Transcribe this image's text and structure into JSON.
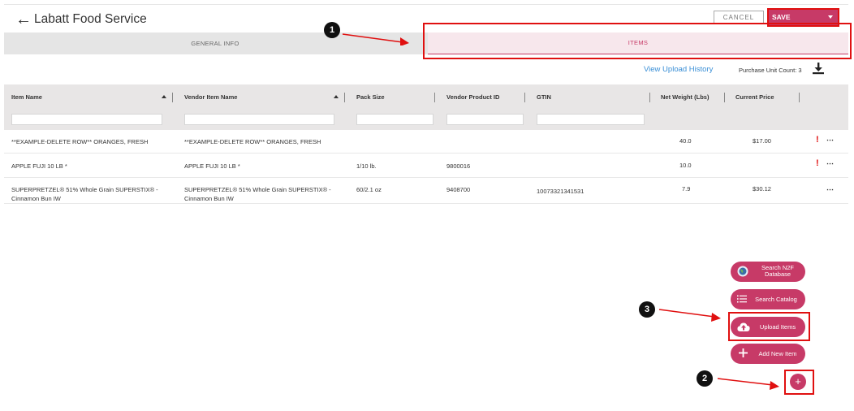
{
  "header": {
    "back_icon": "arrow-left-icon",
    "title": "Labatt Food Service",
    "cancel_label": "CANCEL",
    "save_label": "SAVE"
  },
  "tabs": [
    {
      "label": "GENERAL INFO",
      "active": false
    },
    {
      "label": "ITEMS",
      "active": true
    }
  ],
  "toolbar": {
    "upload_history_link": "View Upload History",
    "purchase_unit_count": "Purchase Unit Count: 3",
    "download_icon": "download-icon"
  },
  "table": {
    "columns": [
      "Item Name",
      "Vendor Item Name",
      "Pack Size",
      "Vendor Product ID",
      "GTIN",
      "Net Weight (Lbs)",
      "Current Price"
    ],
    "rows": [
      {
        "item_name": "**EXAMPLE-DELETE ROW** ORANGES, FRESH",
        "vendor_item_name": "**EXAMPLE-DELETE ROW** ORANGES, FRESH",
        "pack_size": "",
        "vendor_product_id": "",
        "gtin": "",
        "net_weight": "40.0",
        "current_price": "$17.00",
        "warning": "!",
        "menu": "⋯"
      },
      {
        "item_name": "APPLE FUJI 10 LB *",
        "vendor_item_name": "APPLE FUJI 10 LB *",
        "pack_size": "1/10 lb.",
        "vendor_product_id": "9800016",
        "gtin": "",
        "net_weight": "10.0",
        "current_price": "",
        "warning": "!",
        "menu": "⋯"
      },
      {
        "item_name_line1": "SUPERPRETZEL® 51% Whole Grain SUPERSTIX® -",
        "item_name_line2": "Cinnamon Bun IW",
        "vendor_item_name_line1": "SUPERPRETZEL® 51% Whole Grain SUPERSTIX® -",
        "vendor_item_name_line2": "Cinnamon Bun IW",
        "pack_size": "60/2.1 oz",
        "vendor_product_id": "9408700",
        "gtin": "10073321341531",
        "net_weight": "7.9",
        "current_price": "$30.12",
        "menu": "⋯"
      }
    ]
  },
  "fab_menu": [
    {
      "label_line1": "Search N2F",
      "label_line2": "Database",
      "icon": "globe-icon"
    },
    {
      "label": "Search Catalog",
      "icon": "list-icon"
    },
    {
      "label": "Upload Items",
      "icon": "cloud-upload-icon"
    },
    {
      "label": "Add New Item",
      "icon": "plus-icon"
    }
  ],
  "fab_toggle": "+",
  "annotations": [
    "1",
    "2",
    "3"
  ],
  "colors": {
    "accent": "#c73a67",
    "annotation_red": "#e01010",
    "link_blue": "#3a8fd6"
  }
}
